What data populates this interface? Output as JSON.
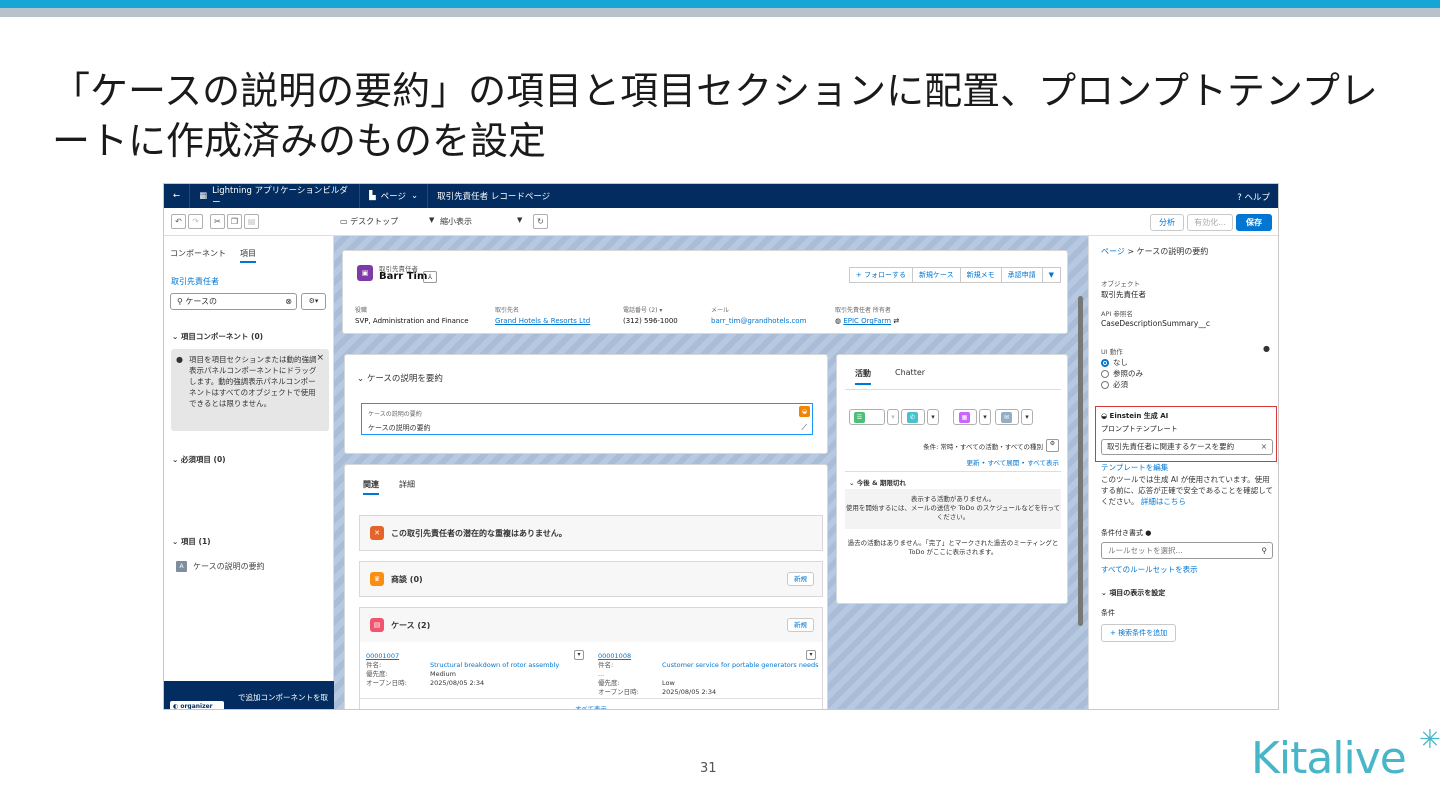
{
  "slide": {
    "title": "「ケースの説明の要約」の項目と項目セクションに配置、プロンプトテンプレートに作成済みのものを設定",
    "page_number": "31",
    "logo": "Kitalive",
    "accent_color": "#16a6d6",
    "highlight_color": "#d93838"
  },
  "header": {
    "back": "←",
    "app_name": "Lightning アプリケーションビルダー",
    "page_menu": "ページ",
    "page_name": "取引先責任者 レコードページ",
    "help": "? ヘルプ"
  },
  "toolbar": {
    "device": "デスクトップ",
    "zoom": "縮小表示",
    "analyze": "分析",
    "activate": "有効化...",
    "save": "保存"
  },
  "left_panel": {
    "tab_components": "コンポーネント",
    "tab_fields": "項目",
    "object": "取引先責任者",
    "search_value": "ケースの",
    "section_field_components": "項目コンポーネント (0)",
    "info_text": "項目を項目セクションまたは動的強調表示パネルコンポーネントにドラッグします。動的強調表示パネルコンポーネントはすべてのオブジェクトで使用できるとは限りません。",
    "section_required": "必須項目 (0)",
    "section_fields": "項目 (1)",
    "field_item": "ケースの説明の要約",
    "bottom_link": "で追加コンポーネントを取得",
    "org_badge": "organizer"
  },
  "highlights": {
    "object_type": "取引先責任者",
    "name": "Barr Tim",
    "actions": [
      "+ フォローする",
      "新規ケース",
      "新規メモ",
      "承認申請"
    ],
    "fields": [
      {
        "label": "役職",
        "value": "SVP, Administration and Finance",
        "link": false
      },
      {
        "label": "取引先名",
        "value": "Grand Hotels & Resorts Ltd",
        "link": true
      },
      {
        "label": "電話番号 (2)",
        "value": "(312) 596-1000",
        "link": false
      },
      {
        "label": "メール",
        "value": "barr_tim@grandhotels.com",
        "link": false
      },
      {
        "label": "取引先責任者 所有者",
        "value": "EPIC OrgFarm",
        "link": true
      }
    ]
  },
  "summary_section": {
    "title": "ケースの説明を要約",
    "field_label": "ケースの説明の要約",
    "field_value": "ケースの説明の要約"
  },
  "related": {
    "tab_related": "関連",
    "tab_detail": "詳細",
    "duplicate_msg": "この取引先責任者の潜在的な重複はありません。",
    "opps": "商談 (0)",
    "cases": "ケース (2)",
    "new_label": "新規",
    "view_all": "すべて表示",
    "case_list": [
      {
        "number": "00001007",
        "subject": "Structural breakdown of rotor assembly",
        "priority": "Medium",
        "opened": "2025/08/05 2:34"
      },
      {
        "number": "00001008",
        "subject": "Customer service for portable generators needs ...",
        "priority": "Low",
        "opened": "2025/08/05 2:34"
      }
    ],
    "key_subject": "件名:",
    "key_priority": "優先度:",
    "key_opened": "オープン日時:"
  },
  "activity": {
    "tab_activity": "活動",
    "tab_chatter": "Chatter",
    "filter_text": "条件: 常時・すべての活動・すべての種別",
    "links": "更新 • すべて展開 • すべて表示",
    "upcoming": "今後 & 期限切れ",
    "no_activity": "表示する活動がありません。",
    "start_hint": "使用を開始するには、メールの送信や ToDo のスケジュールなどを行ってください。",
    "no_past": "過去の活動はありません。「完了」とマークされた過去のミーティングと ToDo がここに表示されます。"
  },
  "right_panel": {
    "breadcrumb_page": "ページ",
    "breadcrumb_sep": ">",
    "breadcrumb_current": "ケースの説明の要約",
    "object_label": "オブジェクト",
    "object_value": "取引先責任者",
    "api_label": "API 参照名",
    "api_value": "CaseDescriptionSummary__c",
    "ui_label": "UI 動作",
    "ui_options": [
      "なし",
      "参照のみ",
      "必須"
    ],
    "einstein_title": "Einstein 生成 AI",
    "prompt_label": "プロンプトテンプレート",
    "prompt_value": "取引先責任者に関連するケースを要約",
    "edit_template": "テンプレートを編集",
    "disclaimer": "このツールでは生成 AI が使用されています。使用する前に、応答が正確で安全であることを確認してください。",
    "details_link": "詳細はこちら",
    "cond_label": "条件付き書式",
    "rule_placeholder": "ルールセットを選択...",
    "all_rules": "すべてのルールセットを表示",
    "visibility": "項目の表示を設定",
    "filter_label": "条件",
    "add_filter": "検索条件を追加"
  }
}
